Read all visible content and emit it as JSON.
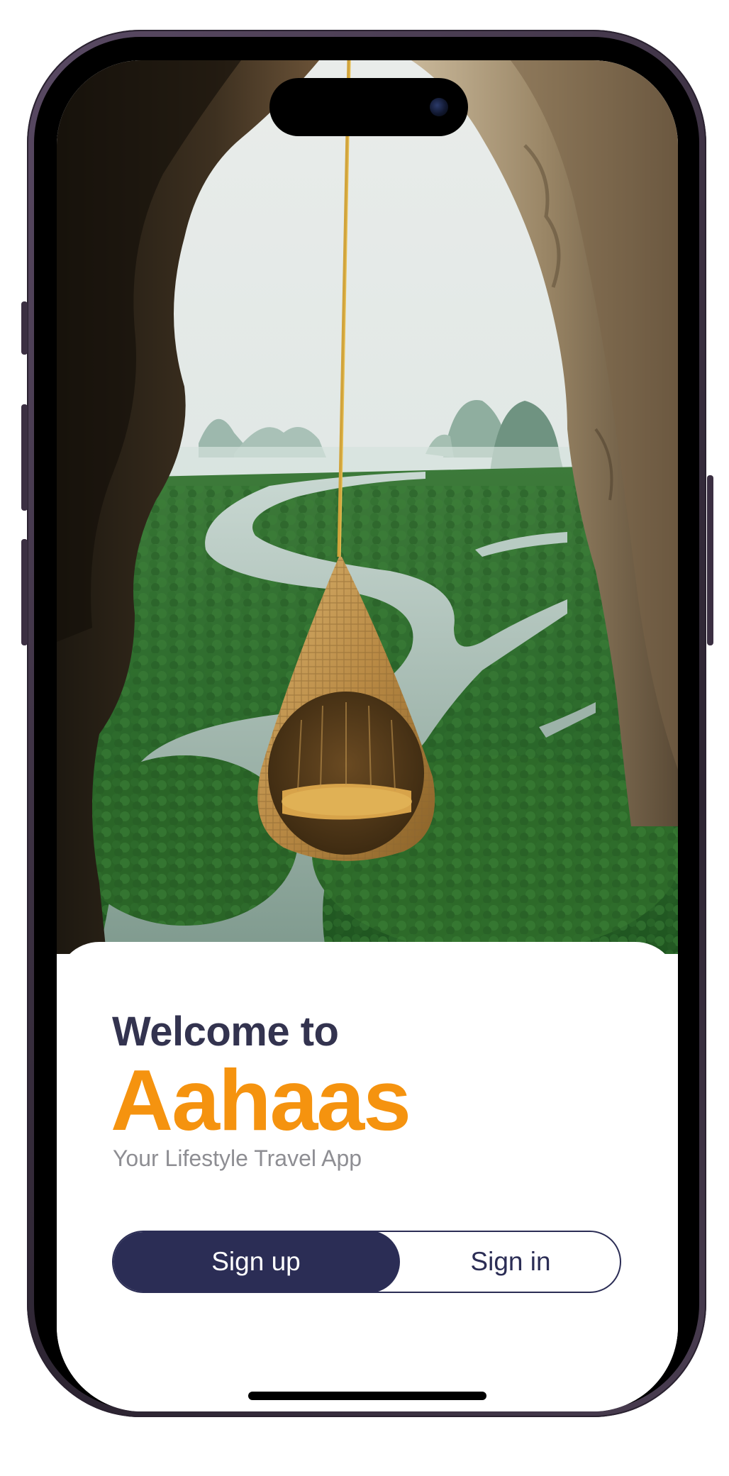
{
  "hero": {
    "image_description_icon": "hanging-rattan-nest-over-mangrove-river-image"
  },
  "welcome": {
    "heading": "Welcome to",
    "app_name": "Aahaas",
    "tagline": "Your Lifestyle Travel App"
  },
  "auth": {
    "signup_label": "Sign up",
    "signin_label": "Sign in",
    "selected": "Sign up"
  },
  "colors": {
    "brand_orange": "#f5930f",
    "navy": "#2b2d55",
    "heading": "#33334f",
    "tagline": "#8e8e93",
    "background": "#ffffff"
  }
}
